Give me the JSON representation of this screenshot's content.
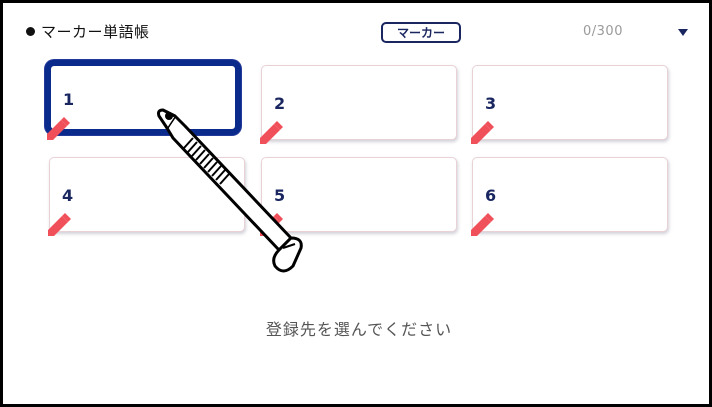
{
  "header": {
    "title": "マーカー単語帳",
    "mode_label": "マーカー",
    "count": "0/300"
  },
  "slots": [
    {
      "label": "1",
      "selected": true
    },
    {
      "label": "2",
      "selected": false
    },
    {
      "label": "3",
      "selected": false
    },
    {
      "label": "4",
      "selected": false
    },
    {
      "label": "5",
      "selected": false
    },
    {
      "label": "6",
      "selected": false
    }
  ],
  "prompt": "登録先を選んでください",
  "colors": {
    "accent": "#0a2a8c",
    "text_dark": "#1a2660",
    "marker": "#f0505a",
    "muted": "#9a9a9a"
  }
}
